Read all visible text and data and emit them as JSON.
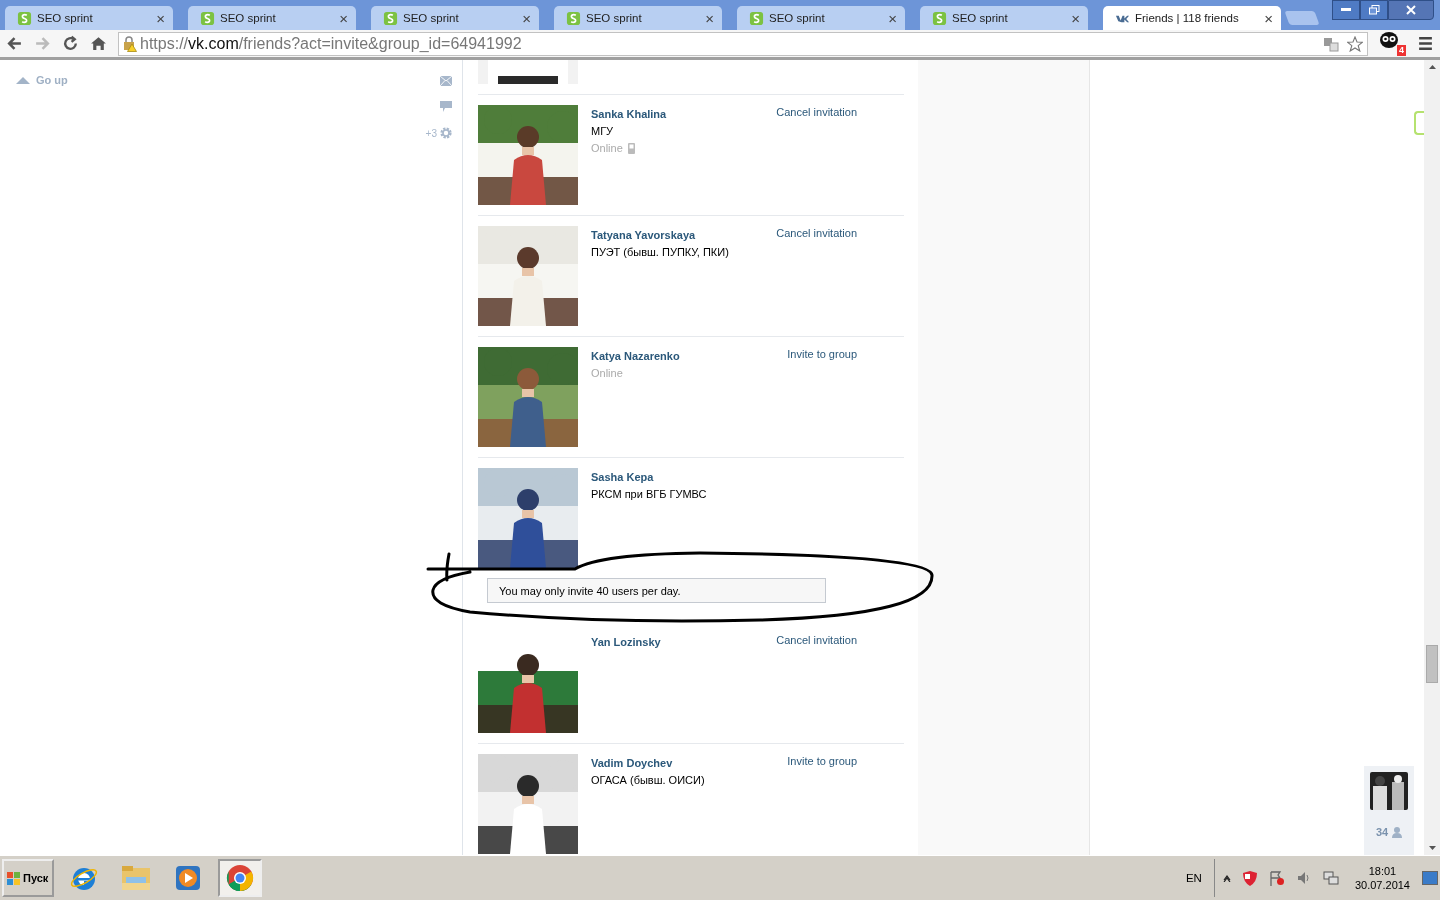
{
  "browser": {
    "tabs": [
      {
        "title": "SEO sprint",
        "kind": "seo",
        "selected": false,
        "close": "×"
      },
      {
        "title": "SEO sprint",
        "kind": "seo",
        "selected": false,
        "close": "×"
      },
      {
        "title": "SEO sprint",
        "kind": "seo",
        "selected": false,
        "close": "×"
      },
      {
        "title": "SEO sprint",
        "kind": "seo",
        "selected": false,
        "close": "×"
      },
      {
        "title": "SEO sprint",
        "kind": "seo",
        "selected": false,
        "close": "×"
      },
      {
        "title": "SEO sprint",
        "kind": "seo",
        "selected": false,
        "close": "×"
      },
      {
        "title": "Friends | 118 friends",
        "kind": "vk",
        "selected": true,
        "close": "×"
      }
    ],
    "address": {
      "scheme": "https://",
      "host": "vk.com",
      "path": "/friends?act=invite&group_id=64941992"
    },
    "extension_badge": "4"
  },
  "left_nav": {
    "go_up": "Go up",
    "counter": "+3"
  },
  "friends": [
    {
      "kind": "cut_photo"
    },
    {
      "kind": "person",
      "name": "Sanka Khalina",
      "subtitle": "МГУ",
      "online": "Online",
      "mobile": true,
      "action": "Cancel invitation"
    },
    {
      "kind": "person",
      "name": "Tatyana Yavorskaya",
      "subtitle": "ПУЭТ (бывш. ПУПКУ, ПКИ)",
      "action": "Cancel invitation"
    },
    {
      "kind": "person",
      "name": "Katya Nazarenko",
      "online": "Online",
      "action": "Invite to group"
    },
    {
      "kind": "person",
      "name": "Sasha Kepa",
      "subtitle": "РКСМ при ВГБ ГУМВС"
    },
    {
      "kind": "notice",
      "text": "You may only invite 40 users per day."
    },
    {
      "kind": "person",
      "name": "Yan Lozinsky",
      "action": "Cancel invitation"
    },
    {
      "kind": "person",
      "name": "Vadim Doychev",
      "subtitle": "ОГАСА (бывш. ОИСИ)",
      "action": "Invite to group"
    }
  ],
  "right_panel": {
    "count": "34"
  },
  "taskbar": {
    "start": "Пуск",
    "apps": [
      {
        "kind": "ie",
        "selected": false
      },
      {
        "kind": "explorer",
        "selected": false
      },
      {
        "kind": "media",
        "selected": false
      },
      {
        "kind": "chrome",
        "selected": true
      }
    ],
    "language": "EN",
    "time": "18:01",
    "date": "30.07.2014"
  }
}
